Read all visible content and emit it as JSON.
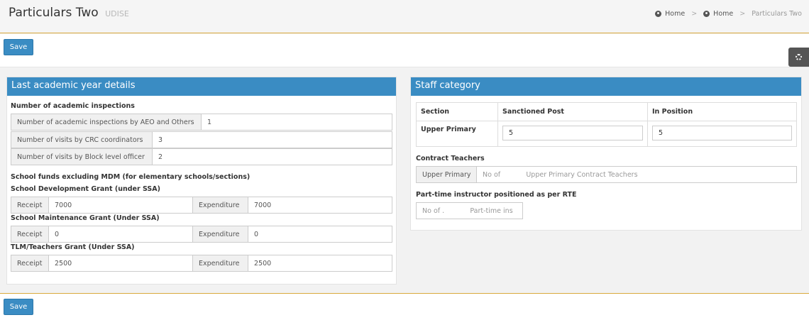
{
  "header": {
    "title": "Particulars Two",
    "subtitle": "UDISE",
    "breadcrumb": [
      "Home",
      "Home",
      "Particulars Two"
    ]
  },
  "actions": {
    "save_label": "Save"
  },
  "last_year": {
    "title": "Last academic year details",
    "inspections_label": "Number of academic inspections",
    "inspections": [
      {
        "label": "Number of academic inspections by AEO and Others",
        "value": "1"
      },
      {
        "label": "Number of visits by CRC coordinators",
        "value": "3"
      },
      {
        "label": "Number of visits by Block level officer",
        "value": "2"
      }
    ],
    "funds_label": "School funds excluding MDM (for elementary schools/sections)",
    "grants": [
      {
        "title": "School Development Grant (under SSA)",
        "receipt_label": "Receipt",
        "receipt": "7000",
        "expenditure_label": "Expenditure",
        "expenditure": "7000"
      },
      {
        "title": "School Maintenance Grant (Under SSA)",
        "receipt_label": "Receipt",
        "receipt": "0",
        "expenditure_label": "Expenditure",
        "expenditure": "0"
      },
      {
        "title": "TLM/Teachers Grant (Under SSA)",
        "receipt_label": "Receipt",
        "receipt": "2500",
        "expenditure_label": "Expenditure",
        "expenditure": "2500"
      }
    ]
  },
  "staff": {
    "title": "Staff category",
    "columns": [
      "Section",
      "Sanctioned Post",
      "In Position"
    ],
    "rows": [
      {
        "section": "Upper Primary",
        "sanctioned": "5",
        "in_position": "5"
      }
    ],
    "contract_label": "Contract Teachers",
    "contract_addon": "Upper Primary",
    "contract_placeholder": "No of            Upper Primary Contract Teachers",
    "parttime_label": "Part-time instructor positioned as per RTE",
    "parttime_placeholder": "No of .            Part-time ins"
  }
}
